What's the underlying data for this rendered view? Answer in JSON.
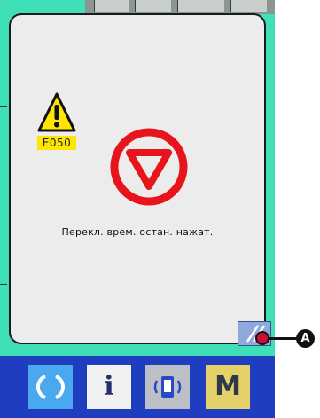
{
  "dialog": {
    "error_code": "E050",
    "message": "Перекл. врем. остан. нажат.",
    "icons": {
      "warning": "warning-triangle-icon",
      "stop": "stop-sign-icon",
      "reset": "reset-icon"
    }
  },
  "callout": {
    "label": "A"
  },
  "bottom_bar": {
    "buttons": [
      {
        "name": "ready-button",
        "icon": "refresh-icon"
      },
      {
        "name": "information-button",
        "icon": "info-icon",
        "label": "i"
      },
      {
        "name": "communication-button",
        "icon": "communication-icon"
      },
      {
        "name": "mode-button",
        "label": "M"
      }
    ]
  },
  "colors": {
    "screen_background": "#3fe0b8",
    "dialog_background": "#ececec",
    "stop_icon": "#e8141c",
    "warning_code_background": "#ffe600",
    "bottom_bar": "#1f3dbf"
  }
}
